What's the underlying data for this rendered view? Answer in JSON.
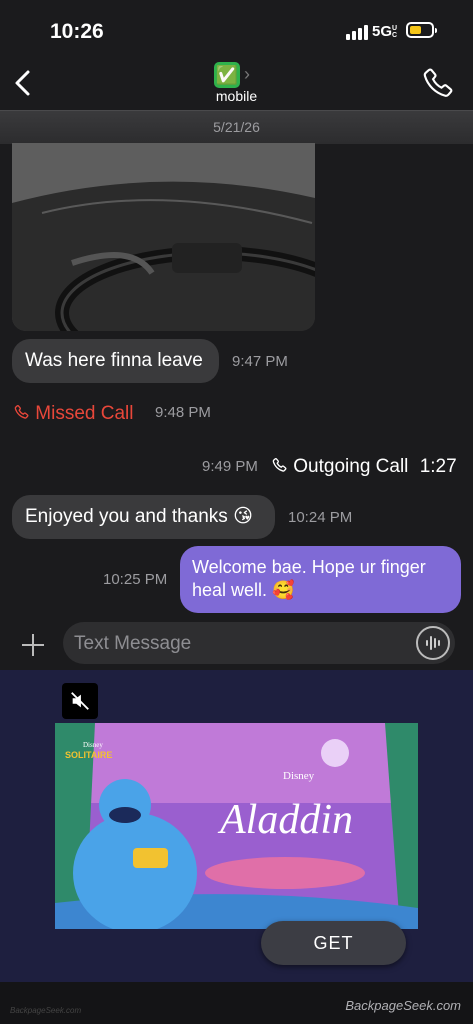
{
  "status_bar": {
    "time": "10:26",
    "network": "5G",
    "network_suffix": "UC",
    "battery_color": "#f5c518"
  },
  "header": {
    "contact_avatar_emoji": "✅",
    "contact_label": "mobile",
    "date": "5/21/26"
  },
  "messages": [
    {
      "type": "image",
      "icon": "photo-steering-wheel"
    },
    {
      "type": "incoming",
      "text": "Was here finna leave",
      "time": "9:47 PM"
    },
    {
      "type": "missed-call",
      "text": "Missed Call",
      "time": "9:48 PM",
      "color": "#e8473a"
    },
    {
      "type": "outgoing-call",
      "text": "Outgoing Call",
      "duration": "1:27",
      "time": "9:49 PM"
    },
    {
      "type": "incoming",
      "text": "Enjoyed you and thanks 😘",
      "time": "10:24 PM"
    },
    {
      "type": "outgoing",
      "text": "Welcome bae. Hope ur finger heal well. 🥰",
      "time": "10:25 PM",
      "color": "#7f6ad6"
    }
  ],
  "composer": {
    "placeholder": "Text Message"
  },
  "ad": {
    "brand": "Disney",
    "game": "SOLITAIRE",
    "title": "Aladdin",
    "button": "GET"
  },
  "watermark": {
    "left": "BackpageSeek.com",
    "right": "BackpageSeek.com"
  }
}
